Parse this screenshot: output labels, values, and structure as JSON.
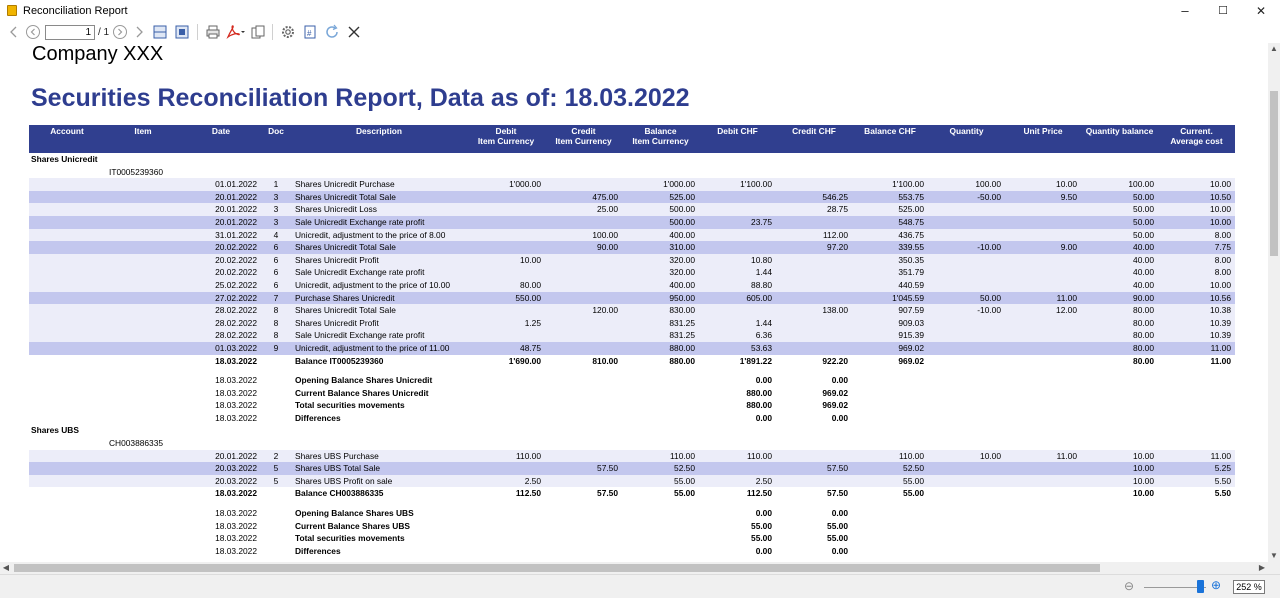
{
  "window": {
    "title": "Reconciliation Report",
    "minimize": "–",
    "maximize": "☐",
    "close": "✕"
  },
  "toolbar": {
    "page_value": "1",
    "page_count": "/ 1"
  },
  "doc": {
    "company": "Company XXX",
    "title": "Securities Reconciliation Report, Data as of: 18.03.2022"
  },
  "table": {
    "headers": [
      "Account",
      "Item",
      "Date",
      "Doc",
      "Description",
      "Debit\nItem Currency",
      "Credit\nItem Currency",
      "Balance\nItem Currency",
      "Debit CHF",
      "Credit CHF",
      "Balance CHF",
      "Quantity",
      "Unit Price",
      "Quantity balance",
      "Current.\nAverage cost"
    ],
    "groups": [
      {
        "account": "Shares Unicredit",
        "item": "IT0005239360",
        "rows": [
          [
            "01.01.2022",
            "1",
            "Shares Unicredit Purchase",
            "1'000.00",
            "",
            "1'000.00",
            "1'100.00",
            "",
            "1'100.00",
            "100.00",
            "10.00",
            "100.00",
            "10.00"
          ],
          [
            "20.01.2022",
            "3",
            "Shares Unicredit Total Sale",
            "",
            "475.00",
            "525.00",
            "",
            "546.25",
            "553.75",
            "-50.00",
            "9.50",
            "50.00",
            "10.50"
          ],
          [
            "20.01.2022",
            "3",
            "Shares Unicredit Loss",
            "",
            "25.00",
            "500.00",
            "",
            "28.75",
            "525.00",
            "",
            "",
            "50.00",
            "10.00"
          ],
          [
            "20.01.2022",
            "3",
            "Sale Unicredit Exchange rate profit",
            "",
            "",
            "500.00",
            "23.75",
            "",
            "548.75",
            "",
            "",
            "50.00",
            "10.00"
          ],
          [
            "31.01.2022",
            "4",
            "Unicredit, adjustment to the price of 8.00",
            "",
            "100.00",
            "400.00",
            "",
            "112.00",
            "436.75",
            "",
            "",
            "50.00",
            "8.00"
          ],
          [
            "20.02.2022",
            "6",
            "Shares Unicredit Total Sale",
            "",
            "90.00",
            "310.00",
            "",
            "97.20",
            "339.55",
            "-10.00",
            "9.00",
            "40.00",
            "7.75"
          ],
          [
            "20.02.2022",
            "6",
            "Shares Unicredit Profit",
            "10.00",
            "",
            "320.00",
            "10.80",
            "",
            "350.35",
            "",
            "",
            "40.00",
            "8.00"
          ],
          [
            "20.02.2022",
            "6",
            "Sale Unicredit Exchange rate profit",
            "",
            "",
            "320.00",
            "1.44",
            "",
            "351.79",
            "",
            "",
            "40.00",
            "8.00"
          ],
          [
            "25.02.2022",
            "6",
            "Unicredit, adjustment to the price of 10.00",
            "80.00",
            "",
            "400.00",
            "88.80",
            "",
            "440.59",
            "",
            "",
            "40.00",
            "10.00"
          ],
          [
            "27.02.2022",
            "7",
            "Purchase Shares Unicredit",
            "550.00",
            "",
            "950.00",
            "605.00",
            "",
            "1'045.59",
            "50.00",
            "11.00",
            "90.00",
            "10.56"
          ],
          [
            "28.02.2022",
            "8",
            "Shares Unicredit Total Sale",
            "",
            "120.00",
            "830.00",
            "",
            "138.00",
            "907.59",
            "-10.00",
            "12.00",
            "80.00",
            "10.38"
          ],
          [
            "28.02.2022",
            "8",
            "Shares Unicredit Profit",
            "1.25",
            "",
            "831.25",
            "1.44",
            "",
            "909.03",
            "",
            "",
            "80.00",
            "10.39"
          ],
          [
            "28.02.2022",
            "8",
            "Sale Unicredit Exchange rate profit",
            "",
            "",
            "831.25",
            "6.36",
            "",
            "915.39",
            "",
            "",
            "80.00",
            "10.39"
          ],
          [
            "01.03.2022",
            "9",
            "Unicredit, adjustment to the price of 11.00",
            "48.75",
            "",
            "880.00",
            "53.63",
            "",
            "969.02",
            "",
            "",
            "80.00",
            "11.00"
          ]
        ],
        "balance": [
          "18.03.2022",
          "",
          "Balance IT0005239360",
          "1'690.00",
          "810.00",
          "880.00",
          "1'891.22",
          "922.20",
          "969.02",
          "",
          "",
          "80.00",
          "11.00"
        ],
        "summary": [
          [
            "18.03.2022",
            "Opening Balance Shares Unicredit",
            "0.00",
            "0.00"
          ],
          [
            "18.03.2022",
            "Current Balance Shares Unicredit",
            "880.00",
            "969.02"
          ],
          [
            "18.03.2022",
            "Total securities movements",
            "880.00",
            "969.02"
          ],
          [
            "18.03.2022",
            "Differences",
            "0.00",
            "0.00"
          ]
        ]
      },
      {
        "account": "Shares UBS",
        "item": "CH003886335",
        "rows": [
          [
            "20.01.2022",
            "2",
            "Shares UBS Purchase",
            "110.00",
            "",
            "110.00",
            "110.00",
            "",
            "110.00",
            "10.00",
            "11.00",
            "10.00",
            "11.00"
          ],
          [
            "20.03.2022",
            "5",
            "Shares UBS Total Sale",
            "",
            "57.50",
            "52.50",
            "",
            "57.50",
            "52.50",
            "",
            "",
            "10.00",
            "5.25"
          ],
          [
            "20.03.2022",
            "5",
            "Shares UBS Profit on sale",
            "2.50",
            "",
            "55.00",
            "2.50",
            "",
            "55.00",
            "",
            "",
            "10.00",
            "5.50"
          ]
        ],
        "balance": [
          "18.03.2022",
          "",
          "Balance CH003886335",
          "112.50",
          "57.50",
          "55.00",
          "112.50",
          "57.50",
          "55.00",
          "",
          "",
          "10.00",
          "5.50"
        ],
        "summary": [
          [
            "18.03.2022",
            "Opening Balance Shares UBS",
            "0.00",
            "0.00"
          ],
          [
            "18.03.2022",
            "Current Balance Shares UBS",
            "55.00",
            "55.00"
          ],
          [
            "18.03.2022",
            "Total securities movements",
            "55.00",
            "55.00"
          ],
          [
            "18.03.2022",
            "Differences",
            "0.00",
            "0.00"
          ]
        ]
      }
    ]
  },
  "status": {
    "zoom": "252 %",
    "zoom_fraction": 0.9
  },
  "colors": {
    "header_bg": "#303f8f",
    "title": "#2e3d8f",
    "row_alt": "#ecedf9",
    "row_shaded": "#c3c7ee",
    "zoom_accent": "#1a73d9"
  }
}
